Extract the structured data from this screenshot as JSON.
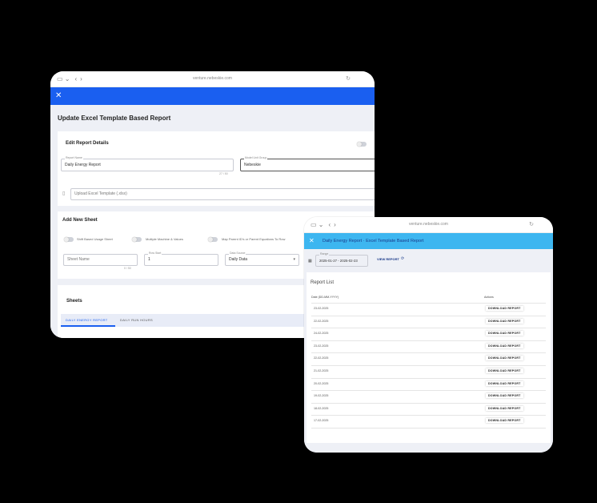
{
  "window1": {
    "url": "venture.nebeskie.com",
    "page_title": "Update Excel Template Based Report",
    "section_details": "Edit Report Details",
    "report_name_caption": "Report Name",
    "report_name": "Daily Energy Report",
    "report_name_count": "27 / 50",
    "group_caption": "Model Unit Group",
    "group_value": "Nebeskie",
    "upload_placeholder": "Upload Excel Template (.xlsx)",
    "section_new_sheet": "Add New Sheet",
    "toggle1": "Shift Based Usage Sheet",
    "toggle2": "Multiple Machine & Values",
    "toggle3": "Map Parent ID's or Parent Equations To Row",
    "sheet_name_placeholder": "Sheet Name",
    "sheet_name_count": "0 / 50",
    "row_start_caption": "Row Start",
    "row_start": "1",
    "data_source_caption": "Data Source",
    "data_source": "Daily Data",
    "section_sheets": "Sheets",
    "tabs": [
      "DAILY ENERGY REPORT",
      "DAILY RUN HOURS"
    ]
  },
  "window2": {
    "url": "venture.nebeskie.com",
    "header_title": "Daily Energy Report · Excel Template Based Report",
    "range_caption": "Range",
    "date_range": "2025-01-27 - 2025-02-23",
    "view_report": "VIEW REPORT",
    "list_title": "Report List",
    "col_date": "Date (DD-MM-YYYY)",
    "col_actions": "Actions",
    "download_label": "DOWNLOAD REPORT",
    "rows": [
      "23-02-2025",
      "22-02-2025",
      "24-02-2025",
      "23-02-2025",
      "22-02-2025",
      "21-02-2025",
      "20-02-2025",
      "19-02-2025",
      "18-02-2025",
      "17-02-2025"
    ]
  },
  "colors": {
    "primary_blue": "#1a5ff0",
    "light_blue": "#3db6f0"
  },
  "icons": [
    "sidebar-icon",
    "back-icon",
    "forward-icon",
    "close-icon",
    "attach-icon",
    "calendar-icon",
    "refresh-icon",
    "reload-icon"
  ]
}
